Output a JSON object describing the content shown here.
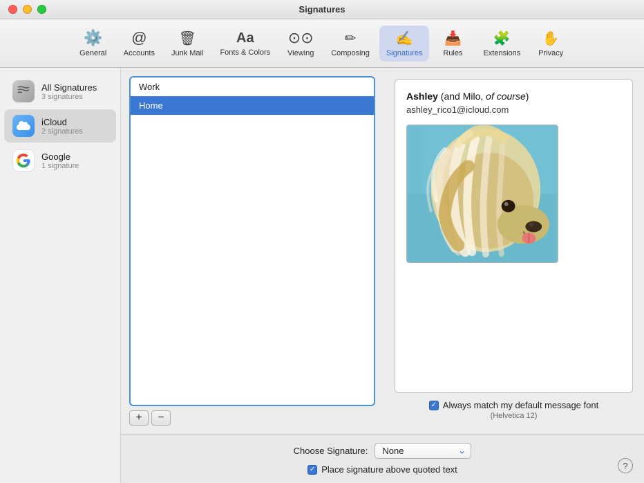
{
  "window": {
    "title": "Signatures"
  },
  "toolbar": {
    "items": [
      {
        "id": "general",
        "label": "General",
        "icon": "⚙️",
        "active": false
      },
      {
        "id": "accounts",
        "label": "Accounts",
        "icon": "✉️",
        "active": false
      },
      {
        "id": "junk-mail",
        "label": "Junk Mail",
        "icon": "🗑️",
        "active": false
      },
      {
        "id": "fonts-colors",
        "label": "Fonts & Colors",
        "icon": "Aa",
        "icon_type": "text",
        "active": false
      },
      {
        "id": "viewing",
        "label": "Viewing",
        "icon": "👓",
        "active": false
      },
      {
        "id": "composing",
        "label": "Composing",
        "icon": "✏️",
        "active": false
      },
      {
        "id": "signatures",
        "label": "Signatures",
        "icon": "✍",
        "active": true
      },
      {
        "id": "rules",
        "label": "Rules",
        "icon": "📥",
        "active": false
      },
      {
        "id": "extensions",
        "label": "Extensions",
        "icon": "🧩",
        "active": false
      },
      {
        "id": "privacy",
        "label": "Privacy",
        "icon": "✋",
        "active": false
      }
    ]
  },
  "sidebar": {
    "items": [
      {
        "id": "all-signatures",
        "name": "All Signatures",
        "count": "3 signatures",
        "icon_type": "all-sig",
        "selected": false
      },
      {
        "id": "icloud",
        "name": "iCloud",
        "count": "2 signatures",
        "icon_type": "icloud",
        "selected": true
      },
      {
        "id": "google",
        "name": "Google",
        "count": "1 signature",
        "icon_type": "google",
        "selected": false
      }
    ]
  },
  "signatures_list": {
    "items": [
      {
        "id": "work",
        "label": "Work",
        "selected": false
      },
      {
        "id": "home",
        "label": "Home",
        "selected": true
      }
    ],
    "add_label": "+",
    "remove_label": "−"
  },
  "preview": {
    "name_bold": "Ashley",
    "name_rest": " (and Milo, ",
    "name_italic": "of course",
    "name_end": ")",
    "email": "ashley_rico1@icloud.com",
    "font_match_label": "Always match my default message font",
    "font_match_sub": "(Helvetica 12)"
  },
  "bottom": {
    "choose_label": "Choose Signature:",
    "choose_value": "None",
    "place_label": "Place signature above quoted text",
    "help_label": "?"
  }
}
